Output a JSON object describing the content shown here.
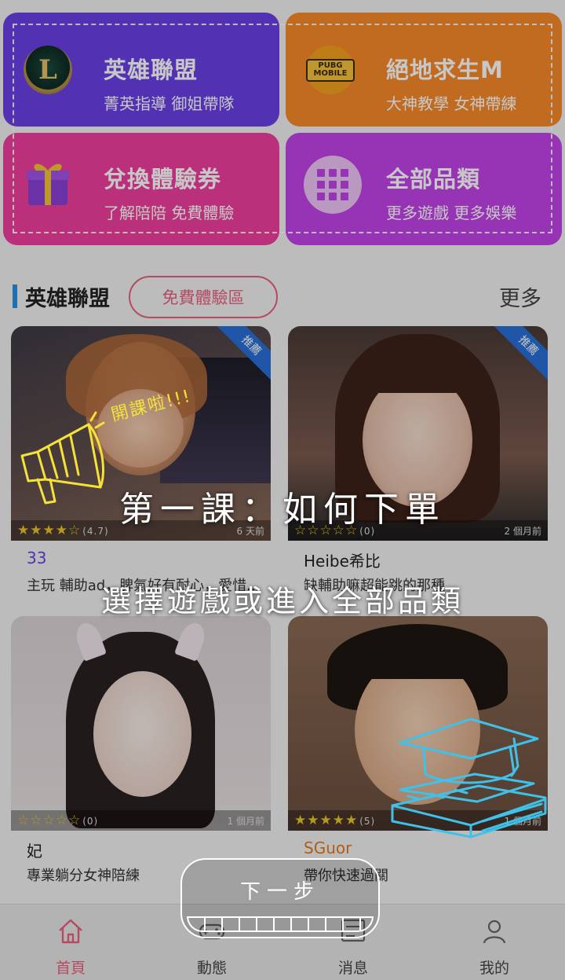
{
  "categories": [
    {
      "title": "英雄聯盟",
      "subtitle": "菁英指導 御姐帶隊",
      "icon": "lol-icon",
      "color": "#6b3fe6"
    },
    {
      "title": "絕地求生M",
      "subtitle": "大神教學 女神帶練",
      "icon": "pubg-mobile-icon",
      "icon_text": "PUBG MOBILE",
      "color": "#f7892a"
    },
    {
      "title": "兌換體驗券",
      "subtitle": "了解陪陪 免費體驗",
      "icon": "gift-icon",
      "color": "#f03e9e"
    },
    {
      "title": "全部品類",
      "subtitle": "更多遊戲 更多娛樂",
      "icon": "grid-icon",
      "color": "#c043e8"
    }
  ],
  "section": {
    "title": "英雄聯盟",
    "free_zone": "免費體驗區",
    "more": "更多"
  },
  "cards": [
    {
      "name": "33",
      "name_color": "#6b3fe6",
      "desc": "主玩 輔助ad，脾氣好有耐心，愛惜...",
      "rating": "(4.7)",
      "stars": 4.7,
      "time": "6 天前",
      "badge": "推薦"
    },
    {
      "name": "Heibe希比",
      "name_color": "#222222",
      "desc": "缺輔助嘛超能跳的那種",
      "rating": "(0)",
      "stars": 0,
      "time": "2 個月前",
      "badge": "推薦"
    },
    {
      "name": "妃",
      "name_color": "#222222",
      "desc": "專業躺分女神陪練",
      "rating": "(0)",
      "stars": 0,
      "time": "1 個月前"
    },
    {
      "name": "SGuor",
      "name_color": "#e07a1c",
      "desc": "帶你快速過關",
      "rating": "(5)",
      "stars": 5,
      "time": "1 個月前"
    }
  ],
  "tutorial": {
    "badge": "開課啦!!!",
    "heading": "第一課：如何下單",
    "instruction": "選擇遊戲或進入全部品類",
    "next": "下一步"
  },
  "nav": [
    {
      "label": "首頁",
      "icon": "home-icon",
      "active": true
    },
    {
      "label": "動態",
      "icon": "gamepad-icon",
      "active": false
    },
    {
      "label": "消息",
      "icon": "message-icon",
      "active": false
    },
    {
      "label": "我的",
      "icon": "user-icon",
      "active": false
    }
  ]
}
